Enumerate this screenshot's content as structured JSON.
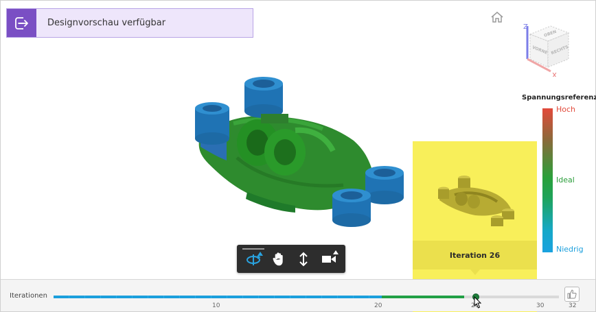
{
  "banner": {
    "text": "Designvorschau verfügbar",
    "icon": "export-arrow-icon",
    "accent_color": "#7a4fc4"
  },
  "viewcube": {
    "faces": [
      "OBEN",
      "VORNE",
      "RECHTS"
    ],
    "axes": [
      "Z",
      "X"
    ]
  },
  "legend": {
    "title": "Spannungsreferenz",
    "high": "Hoch",
    "ideal": "Ideal",
    "low": "Niedrig",
    "colors": {
      "high": "#e24a3b",
      "ideal": "#2aa03a",
      "low": "#1aa2df"
    }
  },
  "toolbar": {
    "tools": [
      {
        "name": "orbit",
        "icon": "orbit-icon",
        "active": true
      },
      {
        "name": "pan",
        "icon": "hand-icon",
        "active": false
      },
      {
        "name": "zoom",
        "icon": "zoom-arrows-icon",
        "active": false
      },
      {
        "name": "camera",
        "icon": "camera-icon",
        "active": false
      }
    ]
  },
  "preview": {
    "label": "Iteration 26",
    "highlight_color": "#f8ef5a"
  },
  "timeline": {
    "label": "Iterationen",
    "ticks": [
      "10",
      "20",
      "26",
      "30",
      "32"
    ],
    "current": 26,
    "max": 32
  }
}
